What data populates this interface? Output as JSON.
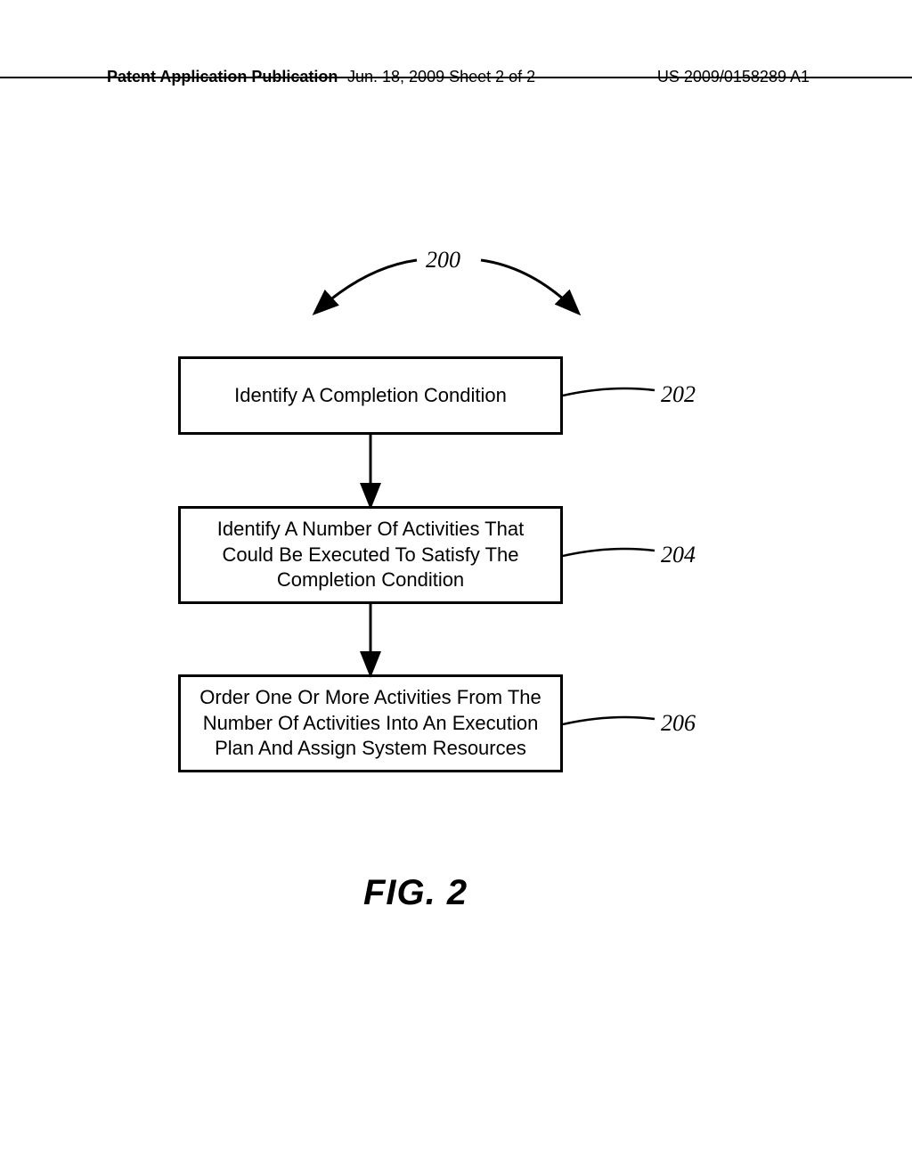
{
  "header": {
    "left": "Patent Application Publication",
    "center": "Jun. 18, 2009  Sheet 2 of 2",
    "right": "US 2009/0158289 A1"
  },
  "refs": {
    "top": "200",
    "b1": "202",
    "b2": "204",
    "b3": "206"
  },
  "boxes": {
    "b1": "Identify A Completion Condition",
    "b2": "Identify A Number Of Activities That Could Be Executed To Satisfy The Completion Condition",
    "b3": "Order One Or More Activities From The Number Of Activities Into An Execution Plan And Assign System Resources"
  },
  "figure_label": "FIG.  2"
}
